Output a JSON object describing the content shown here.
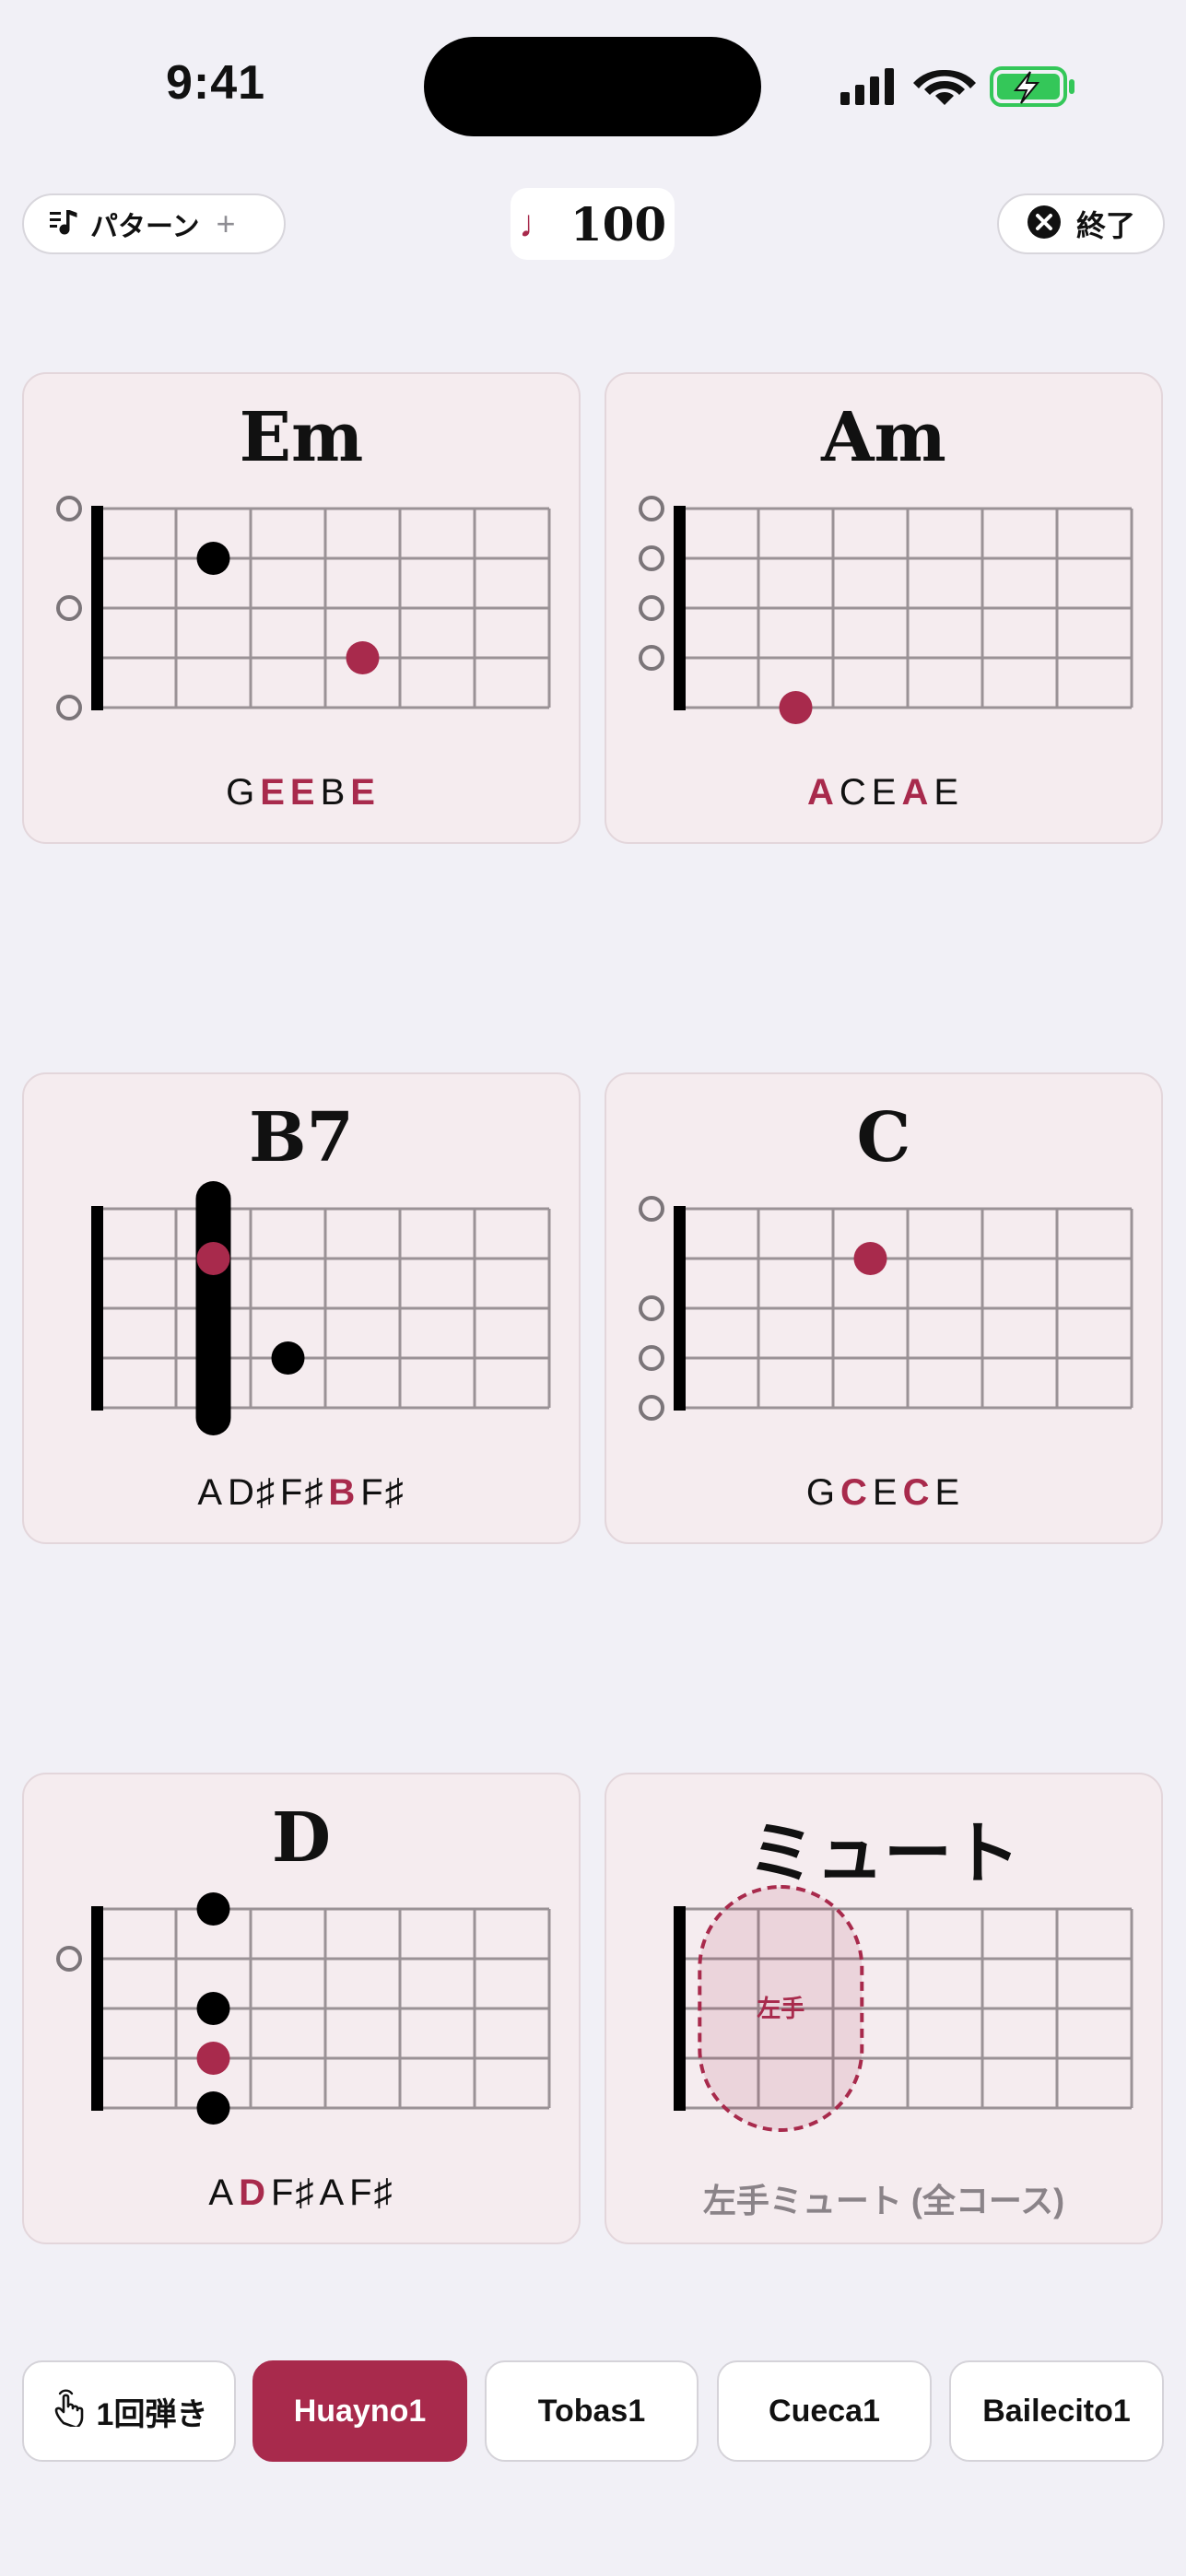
{
  "status": {
    "time": "9:41"
  },
  "topbar": {
    "pattern_label": "パターン",
    "plus": "+",
    "tempo_note": "♩",
    "tempo": "100",
    "end_label": "終了"
  },
  "colors": {
    "accent": "#a82a4c",
    "card_bg": "#f5ecef",
    "page_bg": "#f1f0f6"
  },
  "chords": [
    {
      "name": "Em",
      "open_strings": [
        1,
        3,
        5
      ],
      "dots": [
        {
          "string": 2,
          "fret": 2,
          "root": false
        },
        {
          "string": 4,
          "fret": 4,
          "root": true
        }
      ],
      "barre": null,
      "notes": [
        {
          "t": "G",
          "hl": false
        },
        {
          "t": "E",
          "hl": true
        },
        {
          "t": "E",
          "hl": true
        },
        {
          "t": "B",
          "hl": false
        },
        {
          "t": "E",
          "hl": true
        }
      ]
    },
    {
      "name": "Am",
      "open_strings": [
        1,
        2,
        3,
        4
      ],
      "dots": [
        {
          "string": 5,
          "fret": 2,
          "root": true
        }
      ],
      "barre": null,
      "notes": [
        {
          "t": "A",
          "hl": true
        },
        {
          "t": "C",
          "hl": false
        },
        {
          "t": "E",
          "hl": false
        },
        {
          "t": "A",
          "hl": true
        },
        {
          "t": "E",
          "hl": false
        }
      ]
    },
    {
      "name": "B7",
      "open_strings": [],
      "dots": [
        {
          "string": 2,
          "fret": 2,
          "root": true
        },
        {
          "string": 4,
          "fret": 3,
          "root": false
        }
      ],
      "barre": {
        "fret": 2
      },
      "notes": [
        {
          "t": "A",
          "hl": false
        },
        {
          "t": "D♯",
          "hl": false
        },
        {
          "t": "F♯",
          "hl": false
        },
        {
          "t": "B",
          "hl": true
        },
        {
          "t": "F♯",
          "hl": false
        }
      ]
    },
    {
      "name": "C",
      "open_strings": [
        1,
        3,
        4,
        5
      ],
      "dots": [
        {
          "string": 2,
          "fret": 3,
          "root": true
        }
      ],
      "barre": null,
      "notes": [
        {
          "t": "G",
          "hl": false
        },
        {
          "t": "C",
          "hl": true
        },
        {
          "t": "E",
          "hl": false
        },
        {
          "t": "C",
          "hl": true
        },
        {
          "t": "E",
          "hl": false
        }
      ]
    },
    {
      "name": "D",
      "open_strings": [
        2
      ],
      "dots": [
        {
          "string": 1,
          "fret": 2,
          "root": false
        },
        {
          "string": 3,
          "fret": 2,
          "root": false
        },
        {
          "string": 4,
          "fret": 2,
          "root": true
        },
        {
          "string": 5,
          "fret": 2,
          "root": false
        }
      ],
      "barre": null,
      "notes": [
        {
          "t": "A",
          "hl": false
        },
        {
          "t": "D",
          "hl": true
        },
        {
          "t": "F♯",
          "hl": false
        },
        {
          "t": "A",
          "hl": false
        },
        {
          "t": "F♯",
          "hl": false
        }
      ]
    }
  ],
  "mute": {
    "name": "ミュート",
    "zone_label": "左手",
    "description": "左手ミュート (全コース)"
  },
  "bottom": {
    "single": "1回弾き",
    "patterns": [
      "Huayno1",
      "Tobas1",
      "Cueca1",
      "Bailecito1"
    ],
    "active": "Huayno1"
  }
}
